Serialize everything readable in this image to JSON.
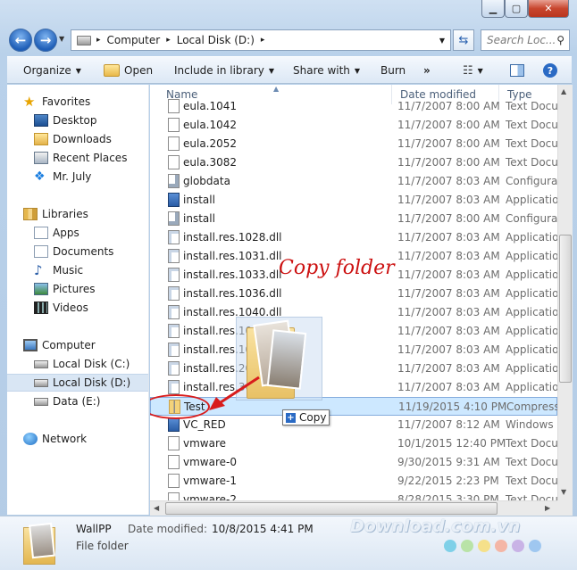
{
  "titlebar": {
    "minimize_icon": "minimize-icon",
    "maximize_icon": "maximize-icon",
    "close_icon": "close-icon"
  },
  "address": {
    "separator": "▸",
    "crumbs": [
      "Computer",
      "Local Disk (D:)"
    ],
    "dropdown_icon": "chevron-down-icon",
    "refresh_icon": "refresh-icon"
  },
  "search": {
    "placeholder": "Search Loc...",
    "icon": "search-icon"
  },
  "toolbar": {
    "organize": "Organize",
    "open": "Open",
    "include_in_library": "Include in library",
    "share_with": "Share with",
    "burn": "Burn",
    "more": "»",
    "view_icon": "view-options-icon",
    "preview_icon": "preview-pane-icon",
    "help_icon": "help-icon"
  },
  "nav": {
    "favorites": "Favorites",
    "desktop": "Desktop",
    "downloads": "Downloads",
    "recent_places": "Recent Places",
    "mr_july": "Mr. July",
    "libraries": "Libraries",
    "apps": "Apps",
    "documents": "Documents",
    "music": "Music",
    "pictures": "Pictures",
    "videos": "Videos",
    "computer": "Computer",
    "local_c": "Local Disk (C:)",
    "local_d": "Local Disk (D:)",
    "data_e": "Data (E:)",
    "network": "Network"
  },
  "columns": {
    "name": "Name",
    "date_modified": "Date modified",
    "type": "Type"
  },
  "files": [
    {
      "name": "eula.1041",
      "date": "11/7/2007 8:00 AM",
      "type": "Text Docum",
      "icon": "text-file-icon"
    },
    {
      "name": "eula.1042",
      "date": "11/7/2007 8:00 AM",
      "type": "Text Docum",
      "icon": "text-file-icon"
    },
    {
      "name": "eula.2052",
      "date": "11/7/2007 8:00 AM",
      "type": "Text Docum",
      "icon": "text-file-icon"
    },
    {
      "name": "eula.3082",
      "date": "11/7/2007 8:00 AM",
      "type": "Text Docum",
      "icon": "text-file-icon"
    },
    {
      "name": "globdata",
      "date": "11/7/2007 8:03 AM",
      "type": "Configurati",
      "icon": "config-file-icon"
    },
    {
      "name": "install",
      "date": "11/7/2007 8:03 AM",
      "type": "Application",
      "icon": "installer-icon"
    },
    {
      "name": "install",
      "date": "11/7/2007 8:00 AM",
      "type": "Configurati",
      "icon": "config-file-icon"
    },
    {
      "name": "install.res.1028.dll",
      "date": "11/7/2007 8:03 AM",
      "type": "Application",
      "icon": "dll-file-icon"
    },
    {
      "name": "install.res.1031.dll",
      "date": "11/7/2007 8:03 AM",
      "type": "Application",
      "icon": "dll-file-icon"
    },
    {
      "name": "install.res.1033.dll",
      "date": "11/7/2007 8:03 AM",
      "type": "Application",
      "icon": "dll-file-icon"
    },
    {
      "name": "install.res.1036.dll",
      "date": "11/7/2007 8:03 AM",
      "type": "Application",
      "icon": "dll-file-icon"
    },
    {
      "name": "install.res.1040.dll",
      "date": "11/7/2007 8:03 AM",
      "type": "Application",
      "icon": "dll-file-icon"
    },
    {
      "name": "install.res.1041.dll",
      "date": "11/7/2007 8:03 AM",
      "type": "Application",
      "icon": "dll-file-icon"
    },
    {
      "name": "install.res.1042.dll",
      "date": "11/7/2007 8:03 AM",
      "type": "Application",
      "icon": "dll-file-icon"
    },
    {
      "name": "install.res.2052.dll",
      "date": "11/7/2007 8:03 AM",
      "type": "Application",
      "icon": "dll-file-icon"
    },
    {
      "name": "install.res.3082.dll",
      "date": "11/7/2007 8:03 AM",
      "type": "Application",
      "icon": "dll-file-icon"
    },
    {
      "name": "Test",
      "date": "11/19/2015 4:10 PM",
      "type": "Compresse",
      "icon": "zip-folder-icon"
    },
    {
      "name": "VC_RED",
      "date": "11/7/2007 8:12 AM",
      "type": "Windows In",
      "icon": "installer-icon"
    },
    {
      "name": "vmware",
      "date": "10/1/2015 12:40 PM",
      "type": "Text Docum",
      "icon": "text-file-icon"
    },
    {
      "name": "vmware-0",
      "date": "9/30/2015 9:31 AM",
      "type": "Text Docum",
      "icon": "text-file-icon"
    },
    {
      "name": "vmware-1",
      "date": "9/22/2015 2:23 PM",
      "type": "Text Docum",
      "icon": "text-file-icon"
    },
    {
      "name": "vmware-2",
      "date": "8/28/2015 3:30 PM",
      "type": "Text Docum",
      "icon": "text-file-icon"
    }
  ],
  "drag": {
    "tooltip_label": "Copy",
    "tooltip_icon": "plus-icon",
    "ghost_icon": "folder-thumbnail-icon"
  },
  "annotation": {
    "text": "Copy folder",
    "color": "#cc1111"
  },
  "details": {
    "item_name": "WallPP",
    "item_type": "File folder",
    "date_label": "Date modified:",
    "date_value": "10/8/2015 4:41 PM"
  },
  "watermark": {
    "text": "Download.com.vn",
    "dot_colors": [
      "#7fd0e8",
      "#b9e3a7",
      "#f5e08a",
      "#f4b6a6",
      "#c9b3e6",
      "#9fc7f0"
    ]
  },
  "colors": {
    "accent": "#1f5fb8",
    "selection": "#cde8ff",
    "selection_border": "#84acdd"
  }
}
